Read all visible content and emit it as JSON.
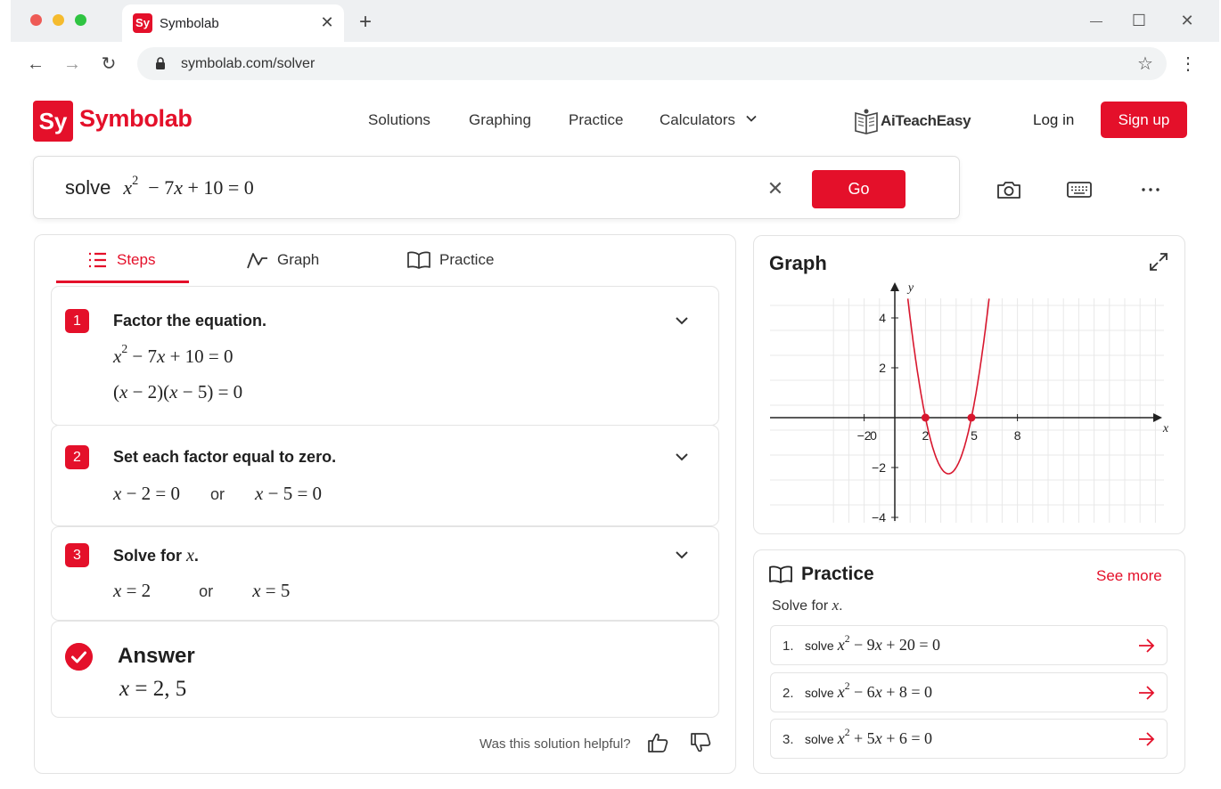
{
  "browser": {
    "tab_title": "Symbolab",
    "favicon_text": "Sy",
    "tab_close": "✕",
    "new_tab": "+",
    "url": "symbolab.com/solver",
    "minimize": "—",
    "maximize": "☐",
    "close": "✕"
  },
  "header": {
    "logo_text": "Sy",
    "site_name": "Symbolab",
    "nav": [
      "Solutions",
      "Graphing",
      "Practice",
      "Calculators"
    ],
    "partner": "AiTeachEasy",
    "login": "Log in",
    "signup": "Sign up"
  },
  "search": {
    "prefix": "solve",
    "equation": "x^2 − 7x + 10 = 0",
    "go": "Go"
  },
  "tabs": [
    "Steps",
    "Graph",
    "Practice"
  ],
  "steps": [
    {
      "number": "1",
      "title": "Factor the equation.",
      "lines": [
        "x^2 − 7x + 10 = 0",
        "(x − 2)(x − 5) = 0"
      ]
    },
    {
      "number": "2",
      "title": "Set each factor equal to zero.",
      "lines": [
        "x − 2 = 0",
        "or",
        "x − 5 = 0"
      ]
    },
    {
      "number": "3",
      "title": "Solve for x.",
      "lines": [
        "x = 2",
        "or",
        "x = 5"
      ]
    }
  ],
  "answer": {
    "title": "Answer",
    "value": "x = 2, 5"
  },
  "feedback": "Was this solution helpful?",
  "graph": {
    "title": "Graph",
    "function": "y = x^2 − 7x + 10",
    "x_label": "x",
    "y_label": "y",
    "x_ticks": [
      "−2",
      "0",
      "2",
      "5",
      "8"
    ],
    "y_ticks": [
      "4",
      "2",
      "−2",
      "−4"
    ],
    "highlight_points": [
      [
        2,
        0
      ],
      [
        5,
        0
      ]
    ],
    "curve_color": "#d8172e"
  },
  "practice": {
    "title": "Practice",
    "see_more": "See more",
    "subtitle": "Solve for x.",
    "problems": [
      {
        "num": "1.",
        "prefix": "solve",
        "equation": "x^2 − 9x + 20 = 0"
      },
      {
        "num": "2.",
        "prefix": "solve",
        "equation": "x^2 − 6x + 8 = 0"
      },
      {
        "num": "3.",
        "prefix": "solve",
        "equation": "x^2 + 5x + 6 = 0"
      }
    ]
  },
  "colors": {
    "accent": "#e4102a",
    "text": "#1f1f1f"
  }
}
